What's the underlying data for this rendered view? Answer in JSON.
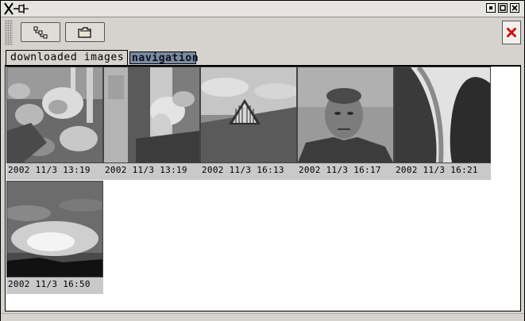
{
  "window": {
    "title_icon": "x-pin-logo",
    "controls": [
      "minimize-icon",
      "maximize-icon",
      "close-icon"
    ]
  },
  "toolbar": {
    "buttons": [
      {
        "name": "connect-button",
        "icon": "network-tree-icon"
      },
      {
        "name": "open-folder-button",
        "icon": "folder-icon"
      }
    ],
    "close_icon": "red-x-icon",
    "close_color": "#cc1111"
  },
  "tabs": [
    {
      "label": "downloaded images",
      "active": true
    },
    {
      "label": "navigation",
      "active": false
    }
  ],
  "colors": {
    "inactive_tab": "#7a8aa0",
    "caption_bg": "#c9c9c9"
  },
  "images": [
    {
      "caption": "2002 11/3 13:19"
    },
    {
      "caption": "2002 11/3 13:19"
    },
    {
      "caption": "2002 11/3 16:13"
    },
    {
      "caption": "2002 11/3 16:17"
    },
    {
      "caption": "2002 11/3 16:21"
    },
    {
      "caption": "2002 11/3 16:50"
    }
  ]
}
